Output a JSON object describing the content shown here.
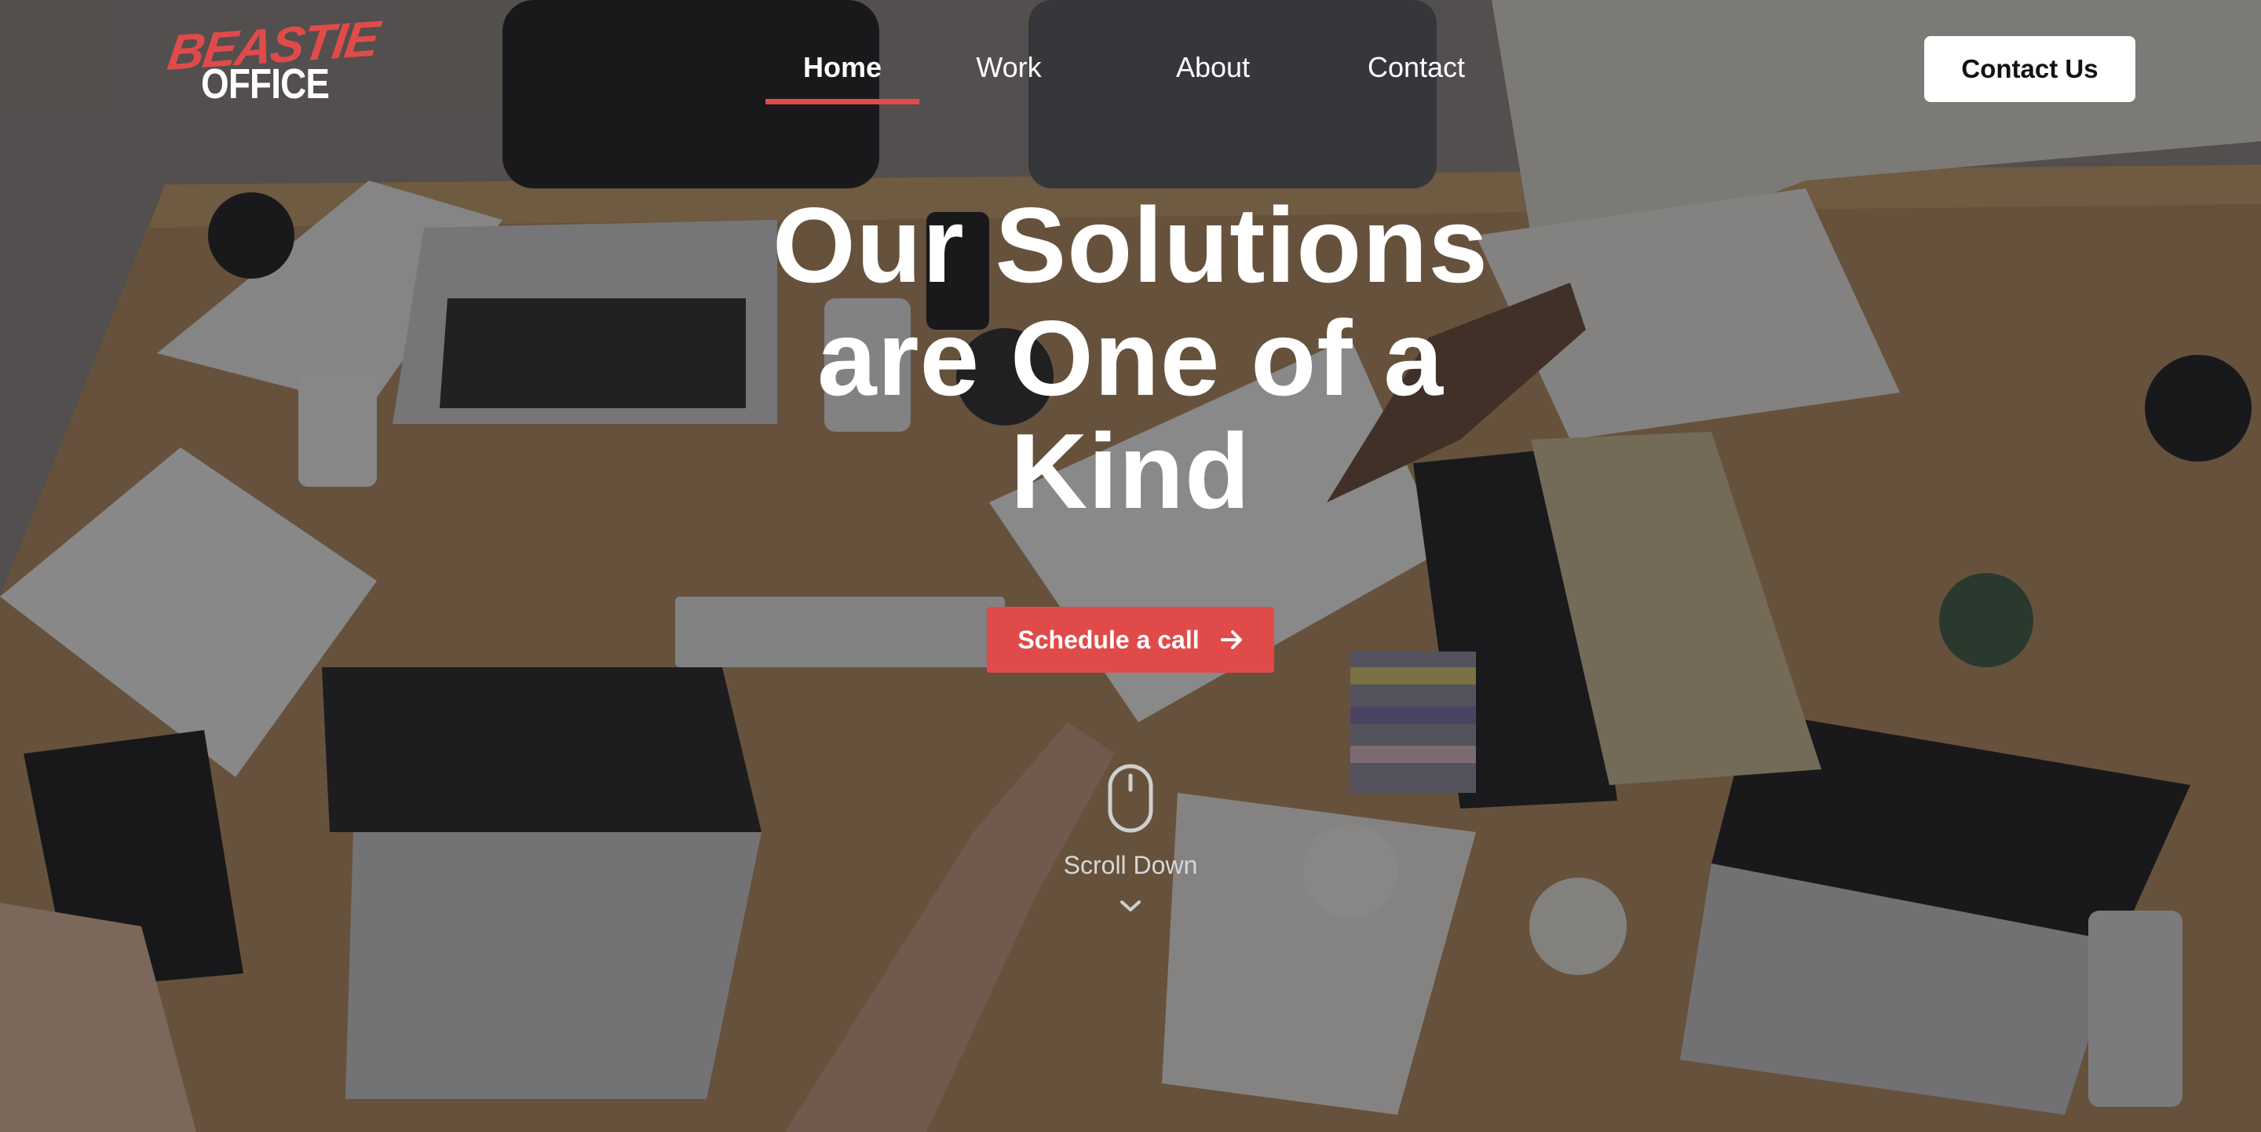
{
  "brand": {
    "logo_top": "BEASTIE",
    "logo_bottom": "OFFICE",
    "accent_color": "#e04b4a"
  },
  "nav": {
    "items": [
      {
        "label": "Home",
        "active": true
      },
      {
        "label": "Work",
        "active": false
      },
      {
        "label": "About",
        "active": false
      },
      {
        "label": "Contact",
        "active": false
      }
    ],
    "contact_button": "Contact Us"
  },
  "hero": {
    "title": "Our Solutions are One of a Kind",
    "cta_label": "Schedule a call",
    "cta_icon": "arrow-right-icon",
    "scroll_label": "Scroll Down",
    "scroll_icons": [
      "mouse-icon",
      "chevron-down-icon"
    ],
    "background": "overhead photo of a team meeting at a wooden table with laptops"
  }
}
